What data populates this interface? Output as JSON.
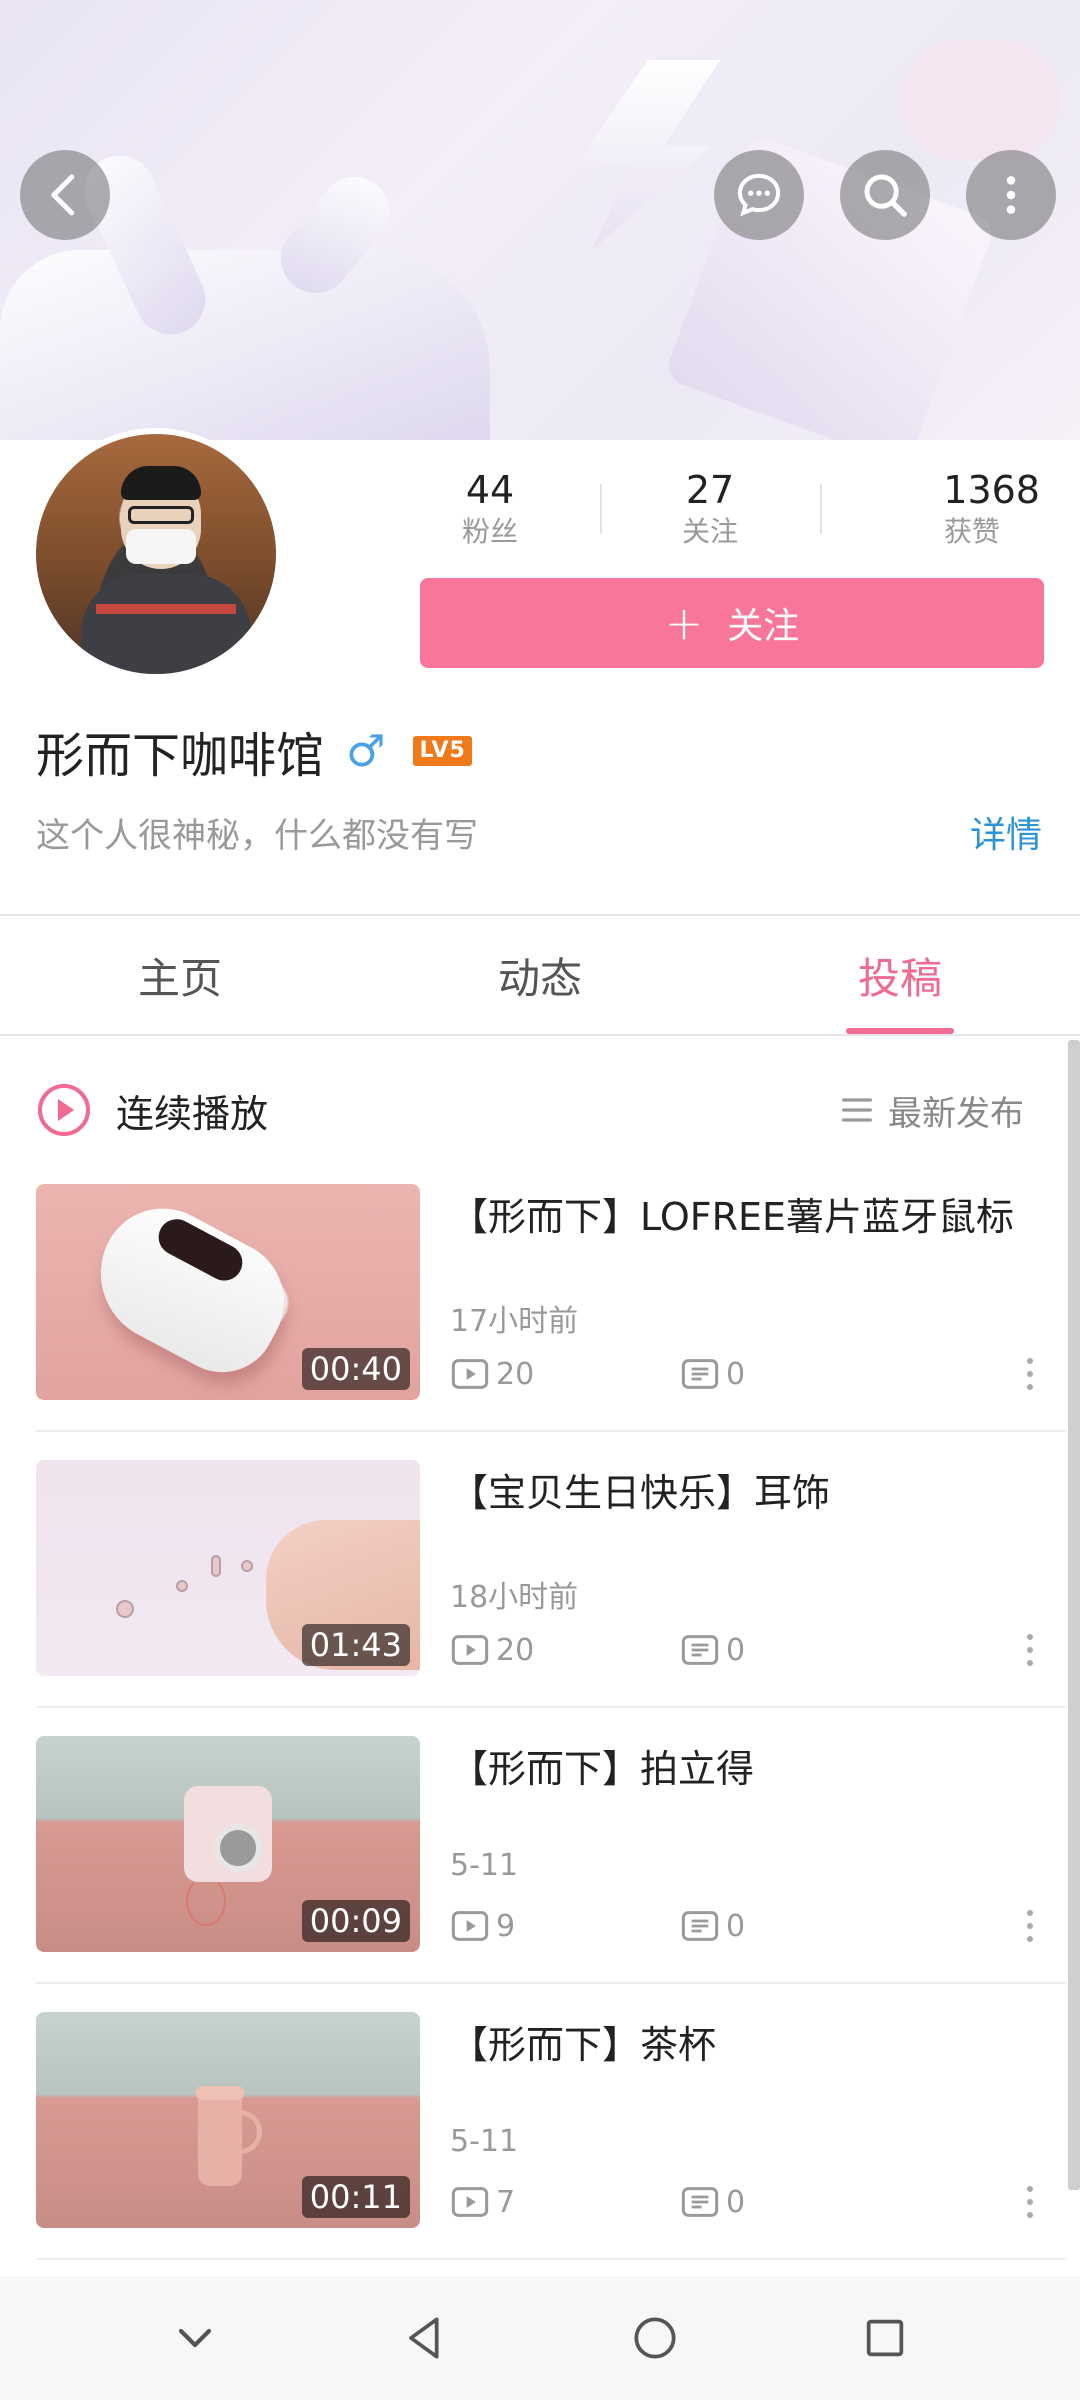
{
  "status_bar": {
    "left_text": "",
    "right_text": ""
  },
  "header": {
    "back_icon": "chevron-left-icon",
    "message_icon": "chat-bubble-icon",
    "search_icon": "search-icon",
    "more_icon": "vertical-dots-icon"
  },
  "profile": {
    "username": "形而下咖啡馆",
    "gender_symbol": "♂",
    "level_badge": "LV5",
    "bio": "这个人很神秘，什么都没有写",
    "details_link": "详情",
    "follow_button": {
      "icon": "+",
      "label": "关注"
    },
    "stats": [
      {
        "value": "44",
        "label": "粉丝"
      },
      {
        "value": "27",
        "label": "关注"
      },
      {
        "value": "1368",
        "label": "获赞"
      }
    ]
  },
  "tabs": [
    {
      "label": "主页",
      "active": false
    },
    {
      "label": "动态",
      "active": false
    },
    {
      "label": "投稿",
      "active": true
    }
  ],
  "list_header": {
    "play_all_label": "连续播放",
    "sort_label": "最新发布"
  },
  "videos": [
    {
      "title": "【形而下】LOFREE薯片蓝牙鼠标",
      "time": "17小时前",
      "duration": "00:40",
      "plays": "20",
      "comments": "0"
    },
    {
      "title": "【宝贝生日快乐】耳饰",
      "time": "18小时前",
      "duration": "01:43",
      "plays": "20",
      "comments": "0"
    },
    {
      "title": "【形而下】拍立得",
      "time": "5-11",
      "duration": "00:09",
      "plays": "9",
      "comments": "0"
    },
    {
      "title": "【形而下】茶杯",
      "time": "5-11",
      "duration": "00:11",
      "plays": "7",
      "comments": "0"
    }
  ],
  "colors": {
    "accent_pink": "#f06a92",
    "follow_button": "#f87699",
    "link_blue": "#2b93d6",
    "gender_blue": "#4aa3e6",
    "level_orange": "#f07a1a"
  },
  "nav_bar": {
    "icons": [
      "chevron-down-icon",
      "back-triangle-icon",
      "home-circle-icon",
      "recents-square-icon"
    ]
  }
}
